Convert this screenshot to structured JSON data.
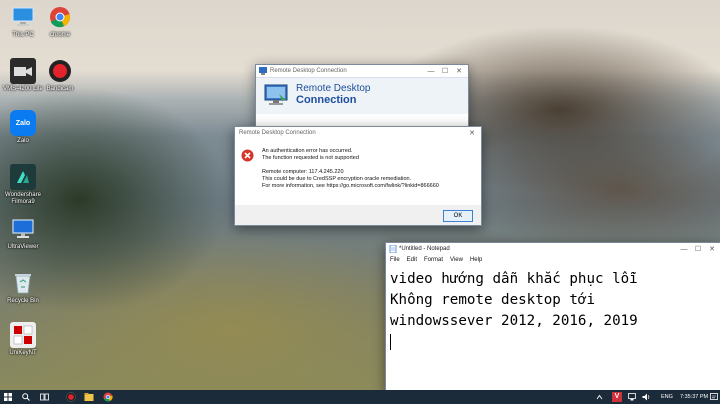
{
  "desktop_icons": [
    {
      "label": "This PC",
      "icon": "computer-icon"
    },
    {
      "label": "chrome",
      "icon": "chrome-icon"
    },
    {
      "label": "VMS-4200 Lite",
      "icon": "video-camera-icon"
    },
    {
      "label": "Bandicam",
      "icon": "record-icon"
    },
    {
      "label": "Zalo",
      "icon": "zalo-icon"
    },
    {
      "label": "Wondershare Filmora9",
      "icon": "filmora-icon"
    },
    {
      "label": "UltraViewer",
      "icon": "monitor-icon"
    },
    {
      "label": "Recycle Bin",
      "icon": "recycle-bin-icon"
    },
    {
      "label": "UniKeyNT",
      "icon": "unikey-icon"
    }
  ],
  "rdc_window": {
    "title": "Remote Desktop Connection",
    "header_line1": "Remote Desktop",
    "header_line2": "Connection"
  },
  "error_dialog": {
    "title": "Remote Desktop Connection",
    "line1": "An authentication error has occurred.",
    "line2": "The function requested is not supported",
    "line3": "Remote computer: 117.4.245.220",
    "line4": "This could be due to CredSSP encryption oracle remediation.",
    "line5": "For more information, see https://go.microsoft.com/fwlink/?linkid=866660",
    "ok_label": "OK"
  },
  "notepad": {
    "title": "*Untitled - Notepad",
    "menu": [
      "File",
      "Edit",
      "Format",
      "View",
      "Help"
    ],
    "lines": [
      "video hướng dẫn khắc phục lỗi",
      "Không remote desktop tới",
      "windowssever 2012, 2016, 2019"
    ]
  },
  "taskbar": {
    "language": "ENG",
    "time": "7:35:37 PM"
  },
  "colors": {
    "taskbar_bg": "#1c2b3a",
    "rdc_title_blue": "#1e4e9c",
    "error_red": "#d9342b",
    "ok_border": "#3c7fd6"
  }
}
